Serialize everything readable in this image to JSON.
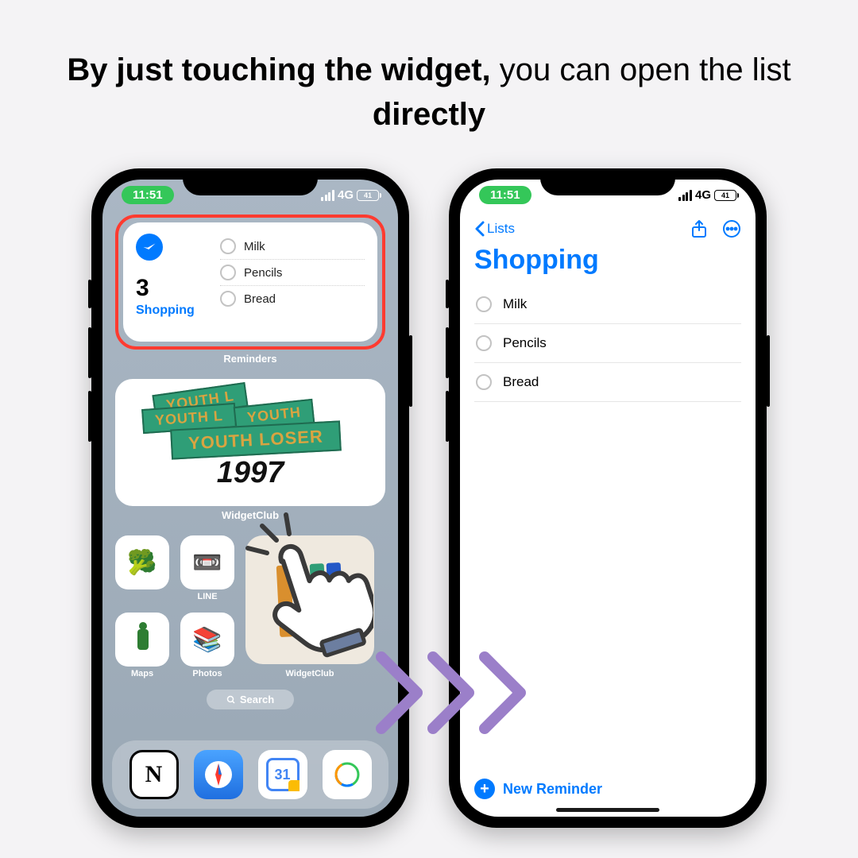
{
  "headline": {
    "bold1": "By just touching the widget,",
    "plain": " you can open the list ",
    "bold2": "directly"
  },
  "status": {
    "time": "11:51",
    "net": "4G",
    "batt": "41"
  },
  "widget": {
    "count": "3",
    "listName": "Shopping",
    "items": [
      "Milk",
      "Pencils",
      "Bread"
    ],
    "appLabel": "Reminders"
  },
  "ylWidget": {
    "tags": [
      "YOUTH L",
      "YOUTH L",
      "YOUTH",
      "YOUTH LOSER"
    ],
    "year": "1997",
    "label": "WidgetClub"
  },
  "apps": {
    "small": [
      {
        "label": "",
        "emoji": "🥦"
      },
      {
        "label": "LINE",
        "emoji": "📼"
      },
      {
        "label": "Maps",
        "emoji": "soldier"
      },
      {
        "label": "Photos",
        "emoji": "📚"
      }
    ],
    "bigLabel": "WidgetClub"
  },
  "search": "Search",
  "dock": [
    "N",
    "🧭",
    "31",
    "✳"
  ],
  "remindersApp": {
    "back": "Lists",
    "title": "Shopping",
    "items": [
      "Milk",
      "Pencils",
      "Bread"
    ],
    "newReminder": "New Reminder"
  },
  "colors": {
    "accent": "#007aff",
    "highlight": "#ff3b30",
    "arrow": "#9b7fc9"
  }
}
